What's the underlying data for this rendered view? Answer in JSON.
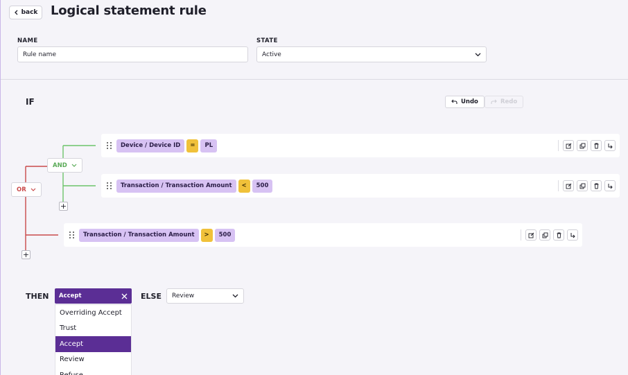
{
  "header": {
    "back_label": "back",
    "title": "Logical statement rule"
  },
  "form": {
    "name_label": "NAME",
    "name_value": "Rule name",
    "state_label": "STATE",
    "state_value": "Active"
  },
  "if_section": {
    "label": "IF",
    "undo_label": "Undo",
    "redo_label": "Redo",
    "root_operator": "OR",
    "group_operator": "AND",
    "conditions": [
      {
        "field": "Device / Device ID",
        "operator": "=",
        "value": "PL"
      },
      {
        "field": "Transaction / Transaction Amount",
        "operator": "<",
        "value": "500"
      },
      {
        "field": "Transaction / Transaction Amount",
        "operator": ">",
        "value": "500"
      }
    ]
  },
  "then_section": {
    "then_label": "THEN",
    "then_value": "Accept",
    "else_label": "ELSE",
    "else_value": "Review",
    "options": [
      "Overriding Accept",
      "Trust",
      "Accept",
      "Review",
      "Refuse"
    ]
  },
  "colors": {
    "brand": "#5b2e95",
    "chip_field": "#d7c2f3",
    "chip_operator": "#f0c13a",
    "and_connector": "#6cc46a",
    "or_connector": "#c94a4a"
  },
  "icons": {
    "back": "chevron-left-icon",
    "dropdown": "chevron-down-icon",
    "undo": "undo-icon",
    "redo": "redo-icon",
    "drag": "drag-handle-icon",
    "edit": "edit-icon",
    "copy": "copy-icon",
    "delete": "trash-icon",
    "nest": "nest-arrow-icon",
    "clear": "close-icon",
    "add": "plus-icon"
  }
}
